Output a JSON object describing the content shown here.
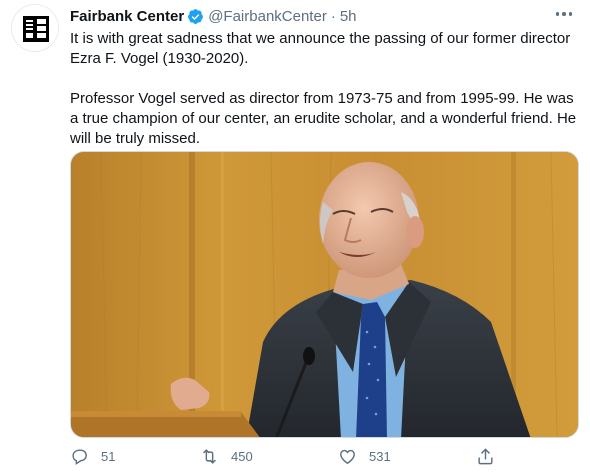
{
  "tweet": {
    "author": {
      "display_name": "Fairbank Center",
      "handle": "@FairbankCenter",
      "separator": "·",
      "time": "5h",
      "verified": true
    },
    "paragraphs": [
      "It is with great sadness that we announce the passing of our former director Ezra F. Vogel (1930-2020).",
      "Professor Vogel served as director from 1973-75 and from 1995-99. He was a true champion of our center, an erudite scholar, and a wonderful friend. He will be truly missed."
    ],
    "actions": {
      "reply_count": "51",
      "retweet_count": "450",
      "like_count": "531"
    },
    "colors": {
      "verified_blue": "#1da1f2",
      "secondary_text": "#5b7083",
      "primary_text": "#0f1419"
    },
    "icons": {
      "reply": "reply-icon",
      "retweet": "retweet-icon",
      "like": "heart-icon",
      "share": "share-icon",
      "more": "more-icon",
      "verified": "verified-badge-icon"
    }
  }
}
